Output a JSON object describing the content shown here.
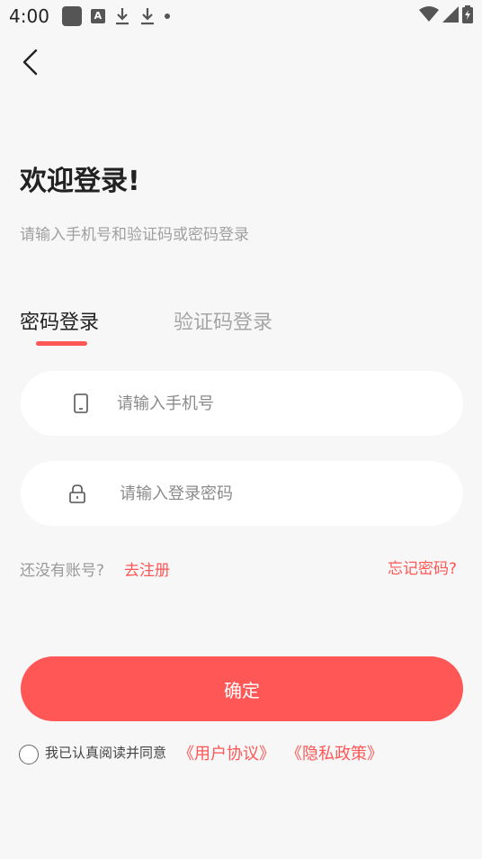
{
  "status_bar": {
    "time": "4:00",
    "left_icons": [
      "app-square-icon",
      "font-a-icon",
      "download-icon",
      "download-icon",
      "notification-dot-icon"
    ],
    "right_icons": [
      "wifi-icon",
      "signal-icon",
      "battery-icon"
    ]
  },
  "nav": {
    "back_icon": "chevron-left-icon"
  },
  "header": {
    "title": "欢迎登录!",
    "subtitle": "请输入手机号和验证码或密码登录"
  },
  "tabs": [
    {
      "label": "密码登录",
      "active": true
    },
    {
      "label": "验证码登录",
      "active": false
    }
  ],
  "form": {
    "phone": {
      "placeholder": "请输入手机号",
      "value": "",
      "icon": "phone-icon"
    },
    "password": {
      "placeholder": "请输入登录密码",
      "value": "",
      "icon": "lock-icon"
    }
  },
  "links": {
    "register_prompt": "还没有账号?",
    "register": "去注册",
    "forgot": "忘记密码?"
  },
  "confirm_label": "确定",
  "agreement": {
    "text": "我已认真阅读并同意",
    "user_agreement": "《用户协议》",
    "privacy_policy": "《隐私政策》",
    "checked": false
  },
  "colors": {
    "accent": "#ff5656",
    "background": "#f7f7f7",
    "input_bg": "#ffffff"
  }
}
